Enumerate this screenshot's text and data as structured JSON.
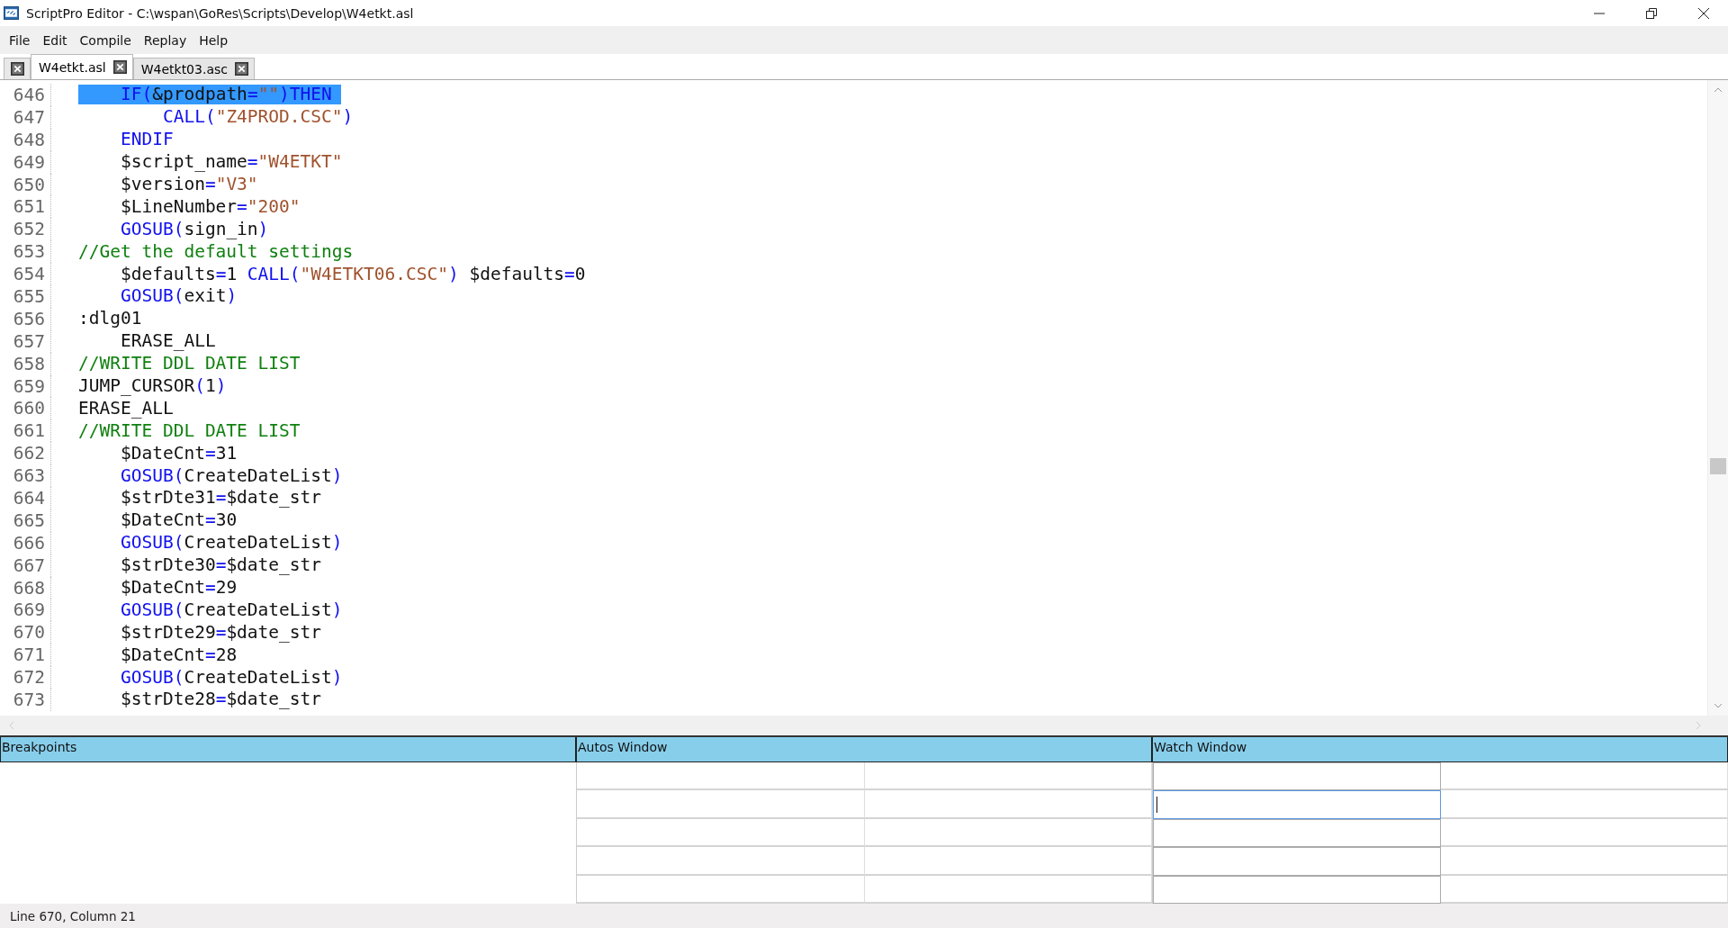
{
  "window": {
    "title": "ScriptPro Editor - C:\\wspan\\GoRes\\Scripts\\Develop\\W4etkt.asl"
  },
  "menu": [
    "File",
    "Edit",
    "Compile",
    "Replay",
    "Help"
  ],
  "tabs": [
    {
      "label": "W4etkt.asl",
      "selected": true
    },
    {
      "label": "W4etkt03.asc",
      "selected": false
    }
  ],
  "editor": {
    "lines": [
      {
        "number": "646",
        "selected": true,
        "tokens": [
          {
            "kind": "kw",
            "text": "    IF"
          },
          {
            "kind": "op",
            "text": "("
          },
          {
            "kind": "plain",
            "text": "&prodpath"
          },
          {
            "kind": "op",
            "text": "="
          },
          {
            "kind": "str",
            "text": "\"\""
          },
          {
            "kind": "op",
            "text": ")"
          },
          {
            "kind": "kw",
            "text": "THEN"
          }
        ]
      },
      {
        "number": "647",
        "selected": false,
        "tokens": [
          {
            "kind": "kw",
            "text": "        CALL"
          },
          {
            "kind": "op",
            "text": "("
          },
          {
            "kind": "str",
            "text": "\"Z4PROD.CSC\""
          },
          {
            "kind": "op",
            "text": ")"
          }
        ]
      },
      {
        "number": "648",
        "selected": false,
        "tokens": [
          {
            "kind": "kw",
            "text": "    ENDIF"
          }
        ]
      },
      {
        "number": "649",
        "selected": false,
        "tokens": [
          {
            "kind": "plain",
            "text": "    $script_name"
          },
          {
            "kind": "op",
            "text": "="
          },
          {
            "kind": "str",
            "text": "\"W4ETKT\""
          }
        ]
      },
      {
        "number": "650",
        "selected": false,
        "tokens": [
          {
            "kind": "plain",
            "text": "    $version"
          },
          {
            "kind": "op",
            "text": "="
          },
          {
            "kind": "str",
            "text": "\"V3\""
          }
        ]
      },
      {
        "number": "651",
        "selected": false,
        "tokens": [
          {
            "kind": "plain",
            "text": "    $LineNumber"
          },
          {
            "kind": "op",
            "text": "="
          },
          {
            "kind": "str",
            "text": "\"200\""
          }
        ]
      },
      {
        "number": "652",
        "selected": false,
        "tokens": [
          {
            "kind": "kw",
            "text": "    GOSUB"
          },
          {
            "kind": "op",
            "text": "("
          },
          {
            "kind": "plain",
            "text": "sign_in"
          },
          {
            "kind": "op",
            "text": ")"
          }
        ]
      },
      {
        "number": "653",
        "selected": false,
        "tokens": [
          {
            "kind": "comment",
            "text": "//Get the default settings"
          }
        ]
      },
      {
        "number": "654",
        "selected": false,
        "tokens": [
          {
            "kind": "plain",
            "text": "    $defaults"
          },
          {
            "kind": "op",
            "text": "="
          },
          {
            "kind": "plain",
            "text": "1 "
          },
          {
            "kind": "kw",
            "text": "CALL"
          },
          {
            "kind": "op",
            "text": "("
          },
          {
            "kind": "str",
            "text": "\"W4ETKT06.CSC\""
          },
          {
            "kind": "op",
            "text": ")"
          },
          {
            "kind": "plain",
            "text": " $defaults"
          },
          {
            "kind": "op",
            "text": "="
          },
          {
            "kind": "plain",
            "text": "0"
          }
        ]
      },
      {
        "number": "655",
        "selected": false,
        "tokens": [
          {
            "kind": "kw",
            "text": "    GOSUB"
          },
          {
            "kind": "op",
            "text": "("
          },
          {
            "kind": "plain",
            "text": "exit"
          },
          {
            "kind": "op",
            "text": ")"
          }
        ]
      },
      {
        "number": "656",
        "selected": false,
        "tokens": [
          {
            "kind": "plain",
            "text": ":dlg01"
          }
        ]
      },
      {
        "number": "657",
        "selected": false,
        "tokens": [
          {
            "kind": "plain",
            "text": "    ERASE_ALL"
          }
        ]
      },
      {
        "number": "658",
        "selected": false,
        "tokens": [
          {
            "kind": "comment",
            "text": "//WRITE DDL DATE LIST"
          }
        ]
      },
      {
        "number": "659",
        "selected": false,
        "tokens": [
          {
            "kind": "plain",
            "text": "JUMP_CURSOR"
          },
          {
            "kind": "op",
            "text": "("
          },
          {
            "kind": "plain",
            "text": "1"
          },
          {
            "kind": "op",
            "text": ")"
          }
        ]
      },
      {
        "number": "660",
        "selected": false,
        "tokens": [
          {
            "kind": "plain",
            "text": "ERASE_ALL"
          }
        ]
      },
      {
        "number": "661",
        "selected": false,
        "tokens": [
          {
            "kind": "comment",
            "text": "//WRITE DDL DATE LIST"
          }
        ]
      },
      {
        "number": "662",
        "selected": false,
        "tokens": [
          {
            "kind": "plain",
            "text": "    $DateCnt"
          },
          {
            "kind": "op",
            "text": "="
          },
          {
            "kind": "plain",
            "text": "31"
          }
        ]
      },
      {
        "number": "663",
        "selected": false,
        "tokens": [
          {
            "kind": "kw",
            "text": "    GOSUB"
          },
          {
            "kind": "op",
            "text": "("
          },
          {
            "kind": "plain",
            "text": "CreateDateList"
          },
          {
            "kind": "op",
            "text": ")"
          }
        ]
      },
      {
        "number": "664",
        "selected": false,
        "tokens": [
          {
            "kind": "plain",
            "text": "    $strDte31"
          },
          {
            "kind": "op",
            "text": "="
          },
          {
            "kind": "plain",
            "text": "$date_str"
          }
        ]
      },
      {
        "number": "665",
        "selected": false,
        "tokens": [
          {
            "kind": "plain",
            "text": "    $DateCnt"
          },
          {
            "kind": "op",
            "text": "="
          },
          {
            "kind": "plain",
            "text": "30"
          }
        ]
      },
      {
        "number": "666",
        "selected": false,
        "tokens": [
          {
            "kind": "kw",
            "text": "    GOSUB"
          },
          {
            "kind": "op",
            "text": "("
          },
          {
            "kind": "plain",
            "text": "CreateDateList"
          },
          {
            "kind": "op",
            "text": ")"
          }
        ]
      },
      {
        "number": "667",
        "selected": false,
        "tokens": [
          {
            "kind": "plain",
            "text": "    $strDte30"
          },
          {
            "kind": "op",
            "text": "="
          },
          {
            "kind": "plain",
            "text": "$date_str"
          }
        ]
      },
      {
        "number": "668",
        "selected": false,
        "tokens": [
          {
            "kind": "plain",
            "text": "    $DateCnt"
          },
          {
            "kind": "op",
            "text": "="
          },
          {
            "kind": "plain",
            "text": "29"
          }
        ]
      },
      {
        "number": "669",
        "selected": false,
        "tokens": [
          {
            "kind": "kw",
            "text": "    GOSUB"
          },
          {
            "kind": "op",
            "text": "("
          },
          {
            "kind": "plain",
            "text": "CreateDateList"
          },
          {
            "kind": "op",
            "text": ")"
          }
        ]
      },
      {
        "number": "670",
        "selected": false,
        "tokens": [
          {
            "kind": "plain",
            "text": "    $strDte29"
          },
          {
            "kind": "op",
            "text": "="
          },
          {
            "kind": "plain",
            "text": "$date_str"
          }
        ]
      },
      {
        "number": "671",
        "selected": false,
        "tokens": [
          {
            "kind": "plain",
            "text": "    $DateCnt"
          },
          {
            "kind": "op",
            "text": "="
          },
          {
            "kind": "plain",
            "text": "28"
          }
        ]
      },
      {
        "number": "672",
        "selected": false,
        "tokens": [
          {
            "kind": "kw",
            "text": "    GOSUB"
          },
          {
            "kind": "op",
            "text": "("
          },
          {
            "kind": "plain",
            "text": "CreateDateList"
          },
          {
            "kind": "op",
            "text": ")"
          }
        ]
      },
      {
        "number": "673",
        "selected": false,
        "tokens": [
          {
            "kind": "plain",
            "text": "    $strDte28"
          },
          {
            "kind": "op",
            "text": "="
          },
          {
            "kind": "plain",
            "text": "$date_str"
          }
        ]
      }
    ]
  },
  "panels": {
    "breakpoints": {
      "title": "Breakpoints"
    },
    "autos": {
      "title": "Autos Window"
    },
    "watch": {
      "title": "Watch Window",
      "rows": [
        {
          "focused": false
        },
        {
          "focused": true
        },
        {
          "focused": false
        },
        {
          "focused": false
        },
        {
          "focused": false
        }
      ]
    }
  },
  "status_bar": "Line 670, Column 21"
}
